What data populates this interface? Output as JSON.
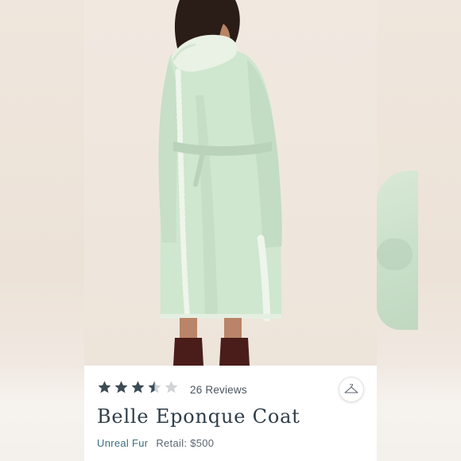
{
  "product": {
    "rating": 3.5,
    "rating_max": 5,
    "reviews_label": "26 Reviews",
    "title": "Belle Eponque Coat",
    "brand": "Unreal Fur",
    "retail": "Retail: $500"
  },
  "icons": {
    "rating_star": "star-icon",
    "save_button": "hanger-icon"
  },
  "colors": {
    "star_filled": "#3d4b55",
    "star_empty": "#d0d4d7",
    "title": "#2f3e49",
    "brand": "#3a6f7d",
    "coat": "#cfe6cf"
  }
}
